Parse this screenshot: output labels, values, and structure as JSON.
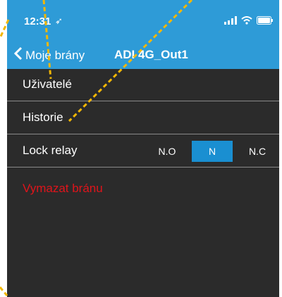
{
  "status": {
    "time": "12:31"
  },
  "nav": {
    "back_label": "Moje brány",
    "title": "ADI 4G_Out1"
  },
  "menu": [
    {
      "label": "Uživatelé"
    },
    {
      "label": "Historie"
    }
  ],
  "lock_relay": {
    "label": "Lock relay",
    "options": [
      "N.O",
      "N",
      "N.C"
    ],
    "selected": "N"
  },
  "delete_label": "Vymazat bránu",
  "colors": {
    "accent": "#2e9bd7",
    "background": "#2b2b2b",
    "danger": "#e0141b",
    "annotation": "#f2b705"
  }
}
